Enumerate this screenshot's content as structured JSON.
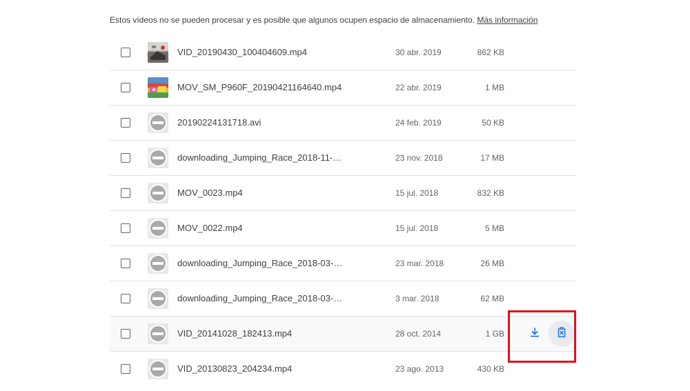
{
  "notice": {
    "text": "Estos vídeos no se pueden procesar y es posible que algunos ocupen espacio de almacenamiento.",
    "link_label": "Más información"
  },
  "files": [
    {
      "name": "VID_20190430_100404609.mp4",
      "date": "30 abr. 2019",
      "size": "862 KB",
      "thumb": "photo-car"
    },
    {
      "name": "MOV_SM_P960F_20190421164640.mp4",
      "date": "22 abr. 2019",
      "size": "1 MB",
      "thumb": "photo-colorful"
    },
    {
      "name": "20190224131718.avi",
      "date": "24 feb. 2019",
      "size": "50 KB",
      "thumb": "blocked-icon"
    },
    {
      "name": "downloading_Jumping_Race_2018-11-…",
      "date": "23 nov. 2018",
      "size": "17 MB",
      "thumb": "blocked-icon"
    },
    {
      "name": "MOV_0023.mp4",
      "date": "15 jul. 2018",
      "size": "832 KB",
      "thumb": "blocked-icon"
    },
    {
      "name": "MOV_0022.mp4",
      "date": "15 jul. 2018",
      "size": "5 MB",
      "thumb": "blocked-icon"
    },
    {
      "name": "downloading_Jumping_Race_2018-03-…",
      "date": "23 mar. 2018",
      "size": "26 MB",
      "thumb": "blocked-icon"
    },
    {
      "name": "downloading_Jumping_Race_2018-03-…",
      "date": "3 mar. 2018",
      "size": "62 MB",
      "thumb": "blocked-icon"
    },
    {
      "name": "VID_20141028_182413.mp4",
      "date": "28 oct. 2014",
      "size": "1 GB",
      "thumb": "blocked-icon"
    },
    {
      "name": "VID_20130823_204234.mp4",
      "date": "23 ago. 2013",
      "size": "430 KB",
      "thumb": "blocked-icon"
    }
  ],
  "hover_row": {
    "download_icon": "download-icon",
    "delete_icon": "delete-icon"
  },
  "colors": {
    "accent": "#1a73e8",
    "highlight": "#e0101b",
    "divider": "#e0e0e0"
  }
}
